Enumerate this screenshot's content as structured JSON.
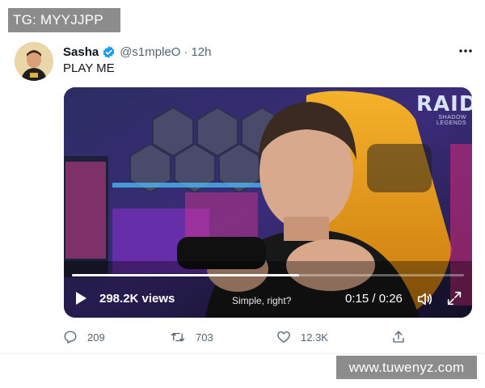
{
  "watermarks": {
    "top_left": "TG: MYYJJPP",
    "bottom_right": "www.tuwenyz.com"
  },
  "tweet": {
    "author_name": "Sasha",
    "handle": "@s1mpleO",
    "separator": "·",
    "time": "12h",
    "verified": true,
    "text": "PLAY ME"
  },
  "video": {
    "channel_logo": "RAID",
    "channel_logo_sub": "SHADOW LEGENDS",
    "views": "298.2K views",
    "caption": "Simple, right?",
    "timecode": "0:15 / 0:26",
    "progress": 0.58
  },
  "actions": {
    "replies": "209",
    "retweets": "703",
    "likes": "12.3K"
  },
  "icons": {
    "more": "more-icon",
    "verified": "verified-badge-icon",
    "play": "play-icon",
    "volume": "volume-icon",
    "fullscreen": "fullscreen-icon",
    "reply": "reply-icon",
    "retweet": "retweet-icon",
    "like": "like-icon",
    "share": "share-icon"
  },
  "colors": {
    "verified_blue": "#1d9bf0",
    "text_primary": "#0f1419",
    "text_secondary": "#536471",
    "watermark_bg": "#8c8c8c",
    "chair_orange": "#f0a020"
  }
}
